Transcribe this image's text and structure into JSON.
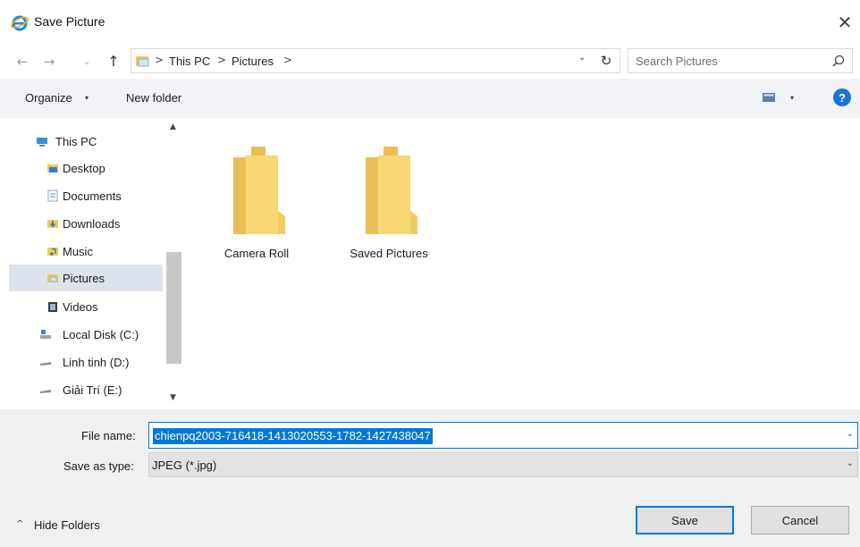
{
  "window": {
    "title": "Save Picture",
    "close_glyph": "✕"
  },
  "nav": {
    "back_glyph": "←",
    "forward_glyph": "→",
    "recent_glyph": "⌄",
    "up_glyph": "↑",
    "breadcrumb": [
      "This PC",
      "Pictures"
    ],
    "separator": ">",
    "dropdown_glyph": "⌄",
    "refresh_glyph": "↻"
  },
  "search": {
    "placeholder": "Search Pictures"
  },
  "toolbar": {
    "organize_label": "Organize",
    "new_folder_label": "New folder",
    "caret": "▾",
    "help_glyph": "?"
  },
  "sidebar": {
    "items": [
      {
        "label": "This PC",
        "icon": "computer-icon"
      },
      {
        "label": "Desktop",
        "icon": "desktop-folder-icon"
      },
      {
        "label": "Documents",
        "icon": "documents-folder-icon"
      },
      {
        "label": "Downloads",
        "icon": "downloads-folder-icon"
      },
      {
        "label": "Music",
        "icon": "music-folder-icon"
      },
      {
        "label": "Pictures",
        "icon": "pictures-folder-icon",
        "selected": true
      },
      {
        "label": "Videos",
        "icon": "videos-folder-icon"
      },
      {
        "label": "Local Disk (C:)",
        "icon": "local-disk-icon"
      },
      {
        "label": "Linh tinh (D:)",
        "icon": "drive-icon"
      },
      {
        "label": "Giải Trí (E:)",
        "icon": "drive-icon"
      }
    ],
    "scroll_up_glyph": "▲",
    "scroll_down_glyph": "▼"
  },
  "content": {
    "folders": [
      {
        "label": "Camera Roll"
      },
      {
        "label": "Saved Pictures"
      }
    ]
  },
  "form": {
    "file_name_label": "File name:",
    "file_name_value": "chienpq2003-716418-1413020553-1782-1427438047",
    "save_type_label": "Save as type:",
    "save_type_value": "JPEG (*.jpg)",
    "dropdown_glyph": "⌄"
  },
  "footer": {
    "hide_folders_label": "Hide Folders",
    "hide_caret": "^",
    "save_label": "Save",
    "cancel_label": "Cancel"
  },
  "colors": {
    "accent": "#0078d7",
    "toolbar_bg": "#f1f3f7",
    "footer_bg": "#f0f0f0",
    "folder_yellow": "#f8d775",
    "selected_bg": "#dde3ec"
  }
}
